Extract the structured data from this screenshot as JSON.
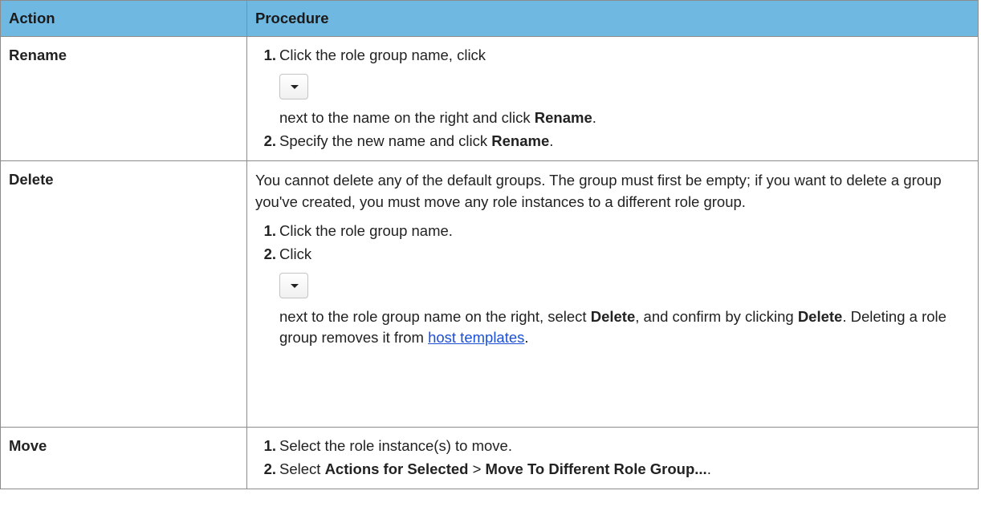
{
  "header": {
    "action": "Action",
    "procedure": "Procedure"
  },
  "rows": [
    {
      "action": "Rename",
      "steps": [
        {
          "num": "1",
          "pre": "Click the role group name, click",
          "post": "next to the name on the right and click ",
          "bold": "Rename",
          "end": "."
        },
        {
          "num": "2",
          "pre": "Specify the new name and click ",
          "bold": "Rename",
          "end": "."
        }
      ]
    },
    {
      "action": "Delete",
      "intro": "You cannot delete any of the default groups. The group must first be empty; if you want to delete a group you've created, you must move any role instances to a different role group.",
      "steps": [
        {
          "num": "1",
          "text": "Click the role group name."
        },
        {
          "num": "2",
          "pre": "Click",
          "post1": "next to the role group name on the right, select ",
          "bold1": "Delete",
          "post2": ", and confirm by clicking ",
          "bold2": "Delete",
          "post3": ". Deleting a role group removes it from ",
          "link": "host templates",
          "end": "."
        }
      ]
    },
    {
      "action": "Move",
      "steps": [
        {
          "num": "1",
          "text": "Select the role instance(s) to move."
        },
        {
          "num": "2",
          "pre": "Select ",
          "bold1": "Actions for Selected",
          "mid": " > ",
          "bold2": "Move To Different Role Group...",
          "end": "."
        }
      ]
    }
  ],
  "icons": {
    "dropdown": "caret-down-icon"
  }
}
